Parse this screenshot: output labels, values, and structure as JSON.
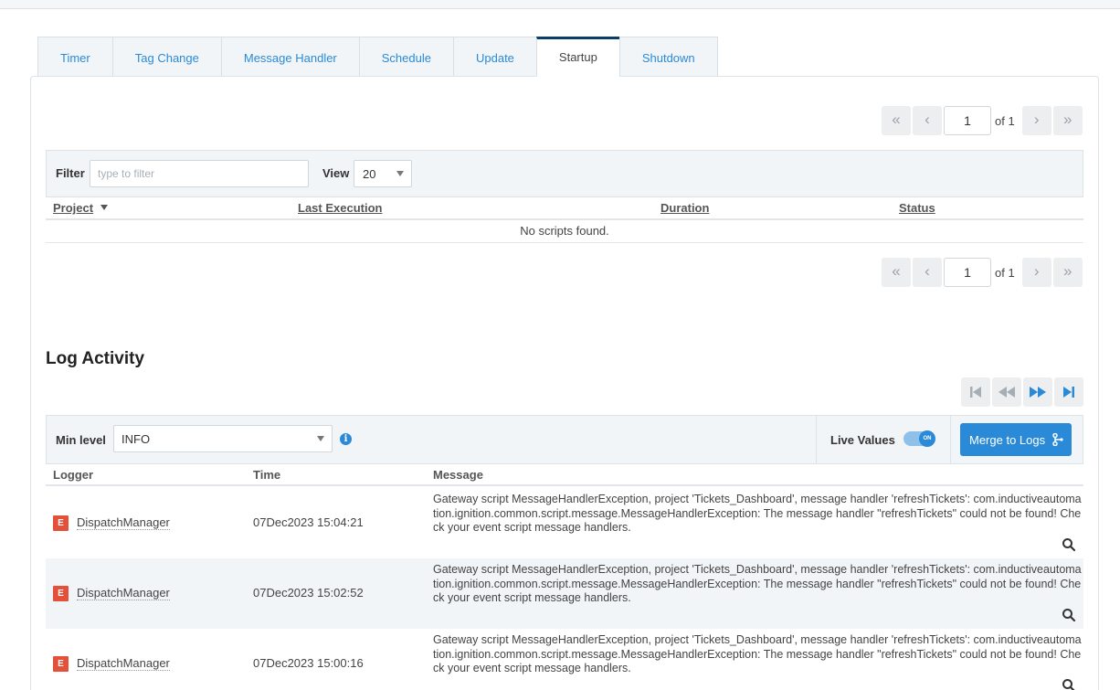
{
  "tabs": [
    {
      "label": "Timer"
    },
    {
      "label": "Tag Change"
    },
    {
      "label": "Message Handler"
    },
    {
      "label": "Schedule"
    },
    {
      "label": "Update"
    },
    {
      "label": "Startup",
      "active": true
    },
    {
      "label": "Shutdown"
    }
  ],
  "pager": {
    "first": "«",
    "prev": "‹",
    "next": "›",
    "last": "»",
    "page": "1",
    "of": "of 1"
  },
  "filter": {
    "label": "Filter",
    "placeholder": "type to filter",
    "view_label": "View",
    "view_value": "20"
  },
  "scripts_table": {
    "columns": [
      "Project",
      "Last Execution",
      "Duration",
      "Status"
    ],
    "empty_text": "No scripts found."
  },
  "log": {
    "title": "Log Activity",
    "min_level_label": "Min level",
    "min_level_value": "INFO",
    "info_icon": "i",
    "live_values_label": "Live Values",
    "toggle_text": "ON",
    "merge_button": "Merge to Logs",
    "columns": [
      "Logger",
      "Time",
      "Message"
    ],
    "rows": [
      {
        "level": "E",
        "logger": "DispatchManager",
        "time": "07Dec2023 15:04:21",
        "message": "Gateway script MessageHandlerException, project 'Tickets_Dashboard', message handler 'refreshTickets': com.inductiveautomation.ignition.common.script.message.MessageHandlerException: The message handler \"refreshTickets\" could not be found! Check your event script message handlers."
      },
      {
        "level": "E",
        "logger": "DispatchManager",
        "time": "07Dec2023 15:02:52",
        "message": "Gateway script MessageHandlerException, project 'Tickets_Dashboard', message handler 'refreshTickets': com.inductiveautomation.ignition.common.script.message.MessageHandlerException: The message handler \"refreshTickets\" could not be found! Check your event script message handlers."
      },
      {
        "level": "E",
        "logger": "DispatchManager",
        "time": "07Dec2023 15:00:16",
        "message": "Gateway script MessageHandlerException, project 'Tickets_Dashboard', message handler 'refreshTickets': com.inductiveautomation.ignition.common.script.message.MessageHandlerException: The message handler \"refreshTickets\" could not be found! Check your event script message handlers."
      }
    ]
  },
  "colors": {
    "accent": "#2a8ad8",
    "active_tab_border": "#0b3d66",
    "error_badge": "#e3513a"
  }
}
